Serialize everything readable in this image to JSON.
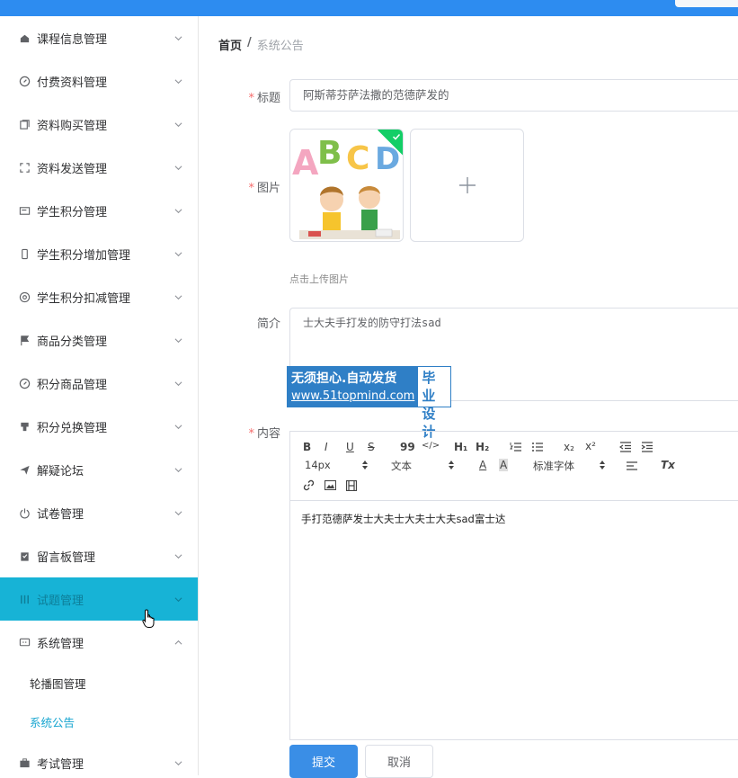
{
  "sidebar": {
    "items": [
      {
        "label": "课程信息管理",
        "icon": "home-icon"
      },
      {
        "label": "付费资料管理",
        "icon": "compass-icon"
      },
      {
        "label": "资料购买管理",
        "icon": "copy-icon"
      },
      {
        "label": "资料发送管理",
        "icon": "fullscreen-icon"
      },
      {
        "label": "学生积分管理",
        "icon": "card-icon"
      },
      {
        "label": "学生积分增加管理",
        "icon": "mobile-icon"
      },
      {
        "label": "学生积分扣减管理",
        "icon": "aperture-icon"
      },
      {
        "label": "商品分类管理",
        "icon": "flag-icon"
      },
      {
        "label": "积分商品管理",
        "icon": "compass-icon"
      },
      {
        "label": "积分兑换管理",
        "icon": "toilet-icon"
      },
      {
        "label": "解疑论坛",
        "icon": "send-icon"
      },
      {
        "label": "试卷管理",
        "icon": "power-icon"
      },
      {
        "label": "留言板管理",
        "icon": "clipboard-icon"
      },
      {
        "label": "试题管理",
        "icon": "grid-icon"
      },
      {
        "label": "系统管理",
        "icon": "chat-icon"
      }
    ],
    "sub_items": [
      {
        "label": "轮播图管理"
      },
      {
        "label": "系统公告"
      }
    ],
    "last_item": {
      "label": "考试管理",
      "icon": "briefcase-icon"
    }
  },
  "breadcrumb": {
    "home": "首页",
    "separator": "/",
    "current": "系统公告"
  },
  "form": {
    "title_label": "标题",
    "title_value": "阿斯蒂芬萨法撒的范德萨发的",
    "image_label": "图片",
    "upload_tip": "点击上传图片",
    "intro_label": "简介",
    "intro_value": "士大夫手打发的防守打法sad",
    "content_label": "内容",
    "required_mark": "*"
  },
  "editor": {
    "font_size": "14px",
    "format": "文本",
    "font_family": "标准字体",
    "content": "手打范德萨发士大夫士大夫士大夫sad富士达",
    "tb_bold": "B",
    "tb_italic": "I",
    "tb_underline": "U",
    "tb_strike": "S",
    "tb_quote": "99",
    "tb_code": "</>",
    "tb_h1": "H₁",
    "tb_h2": "H₂",
    "tb_sub": "x₂",
    "tb_sup": "x²",
    "tb_color": "A",
    "tb_bg": "A",
    "tb_clear": "Tx"
  },
  "watermark": {
    "line1": "无须担心.自动发货",
    "line2": "www.51topmind.com",
    "right_line1": "毕业",
    "right_line2": "设计"
  },
  "buttons": {
    "submit": "提交",
    "cancel": "取消"
  },
  "colors": {
    "primary": "#3a8ee6",
    "active_menu": "#17b3d6",
    "topbar": "#2d8cf0",
    "required": "#f56c6c"
  }
}
